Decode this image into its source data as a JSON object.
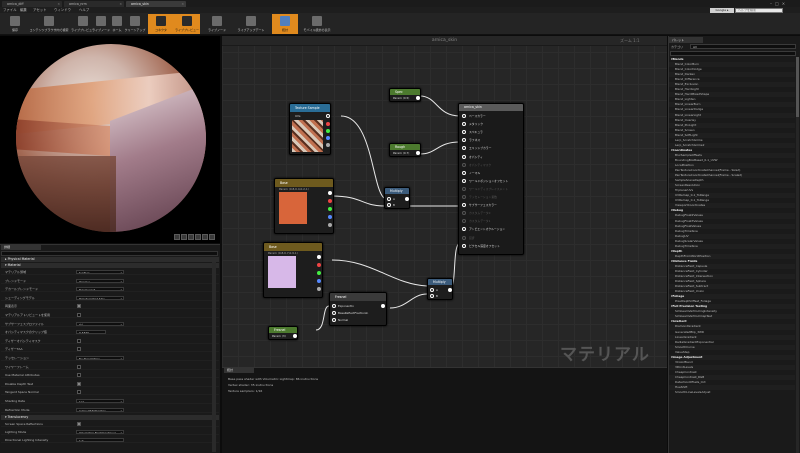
{
  "tabs": [
    {
      "label": "arnica_diff"
    },
    {
      "label": "arnica_nrm"
    },
    {
      "label": "arnica_skin"
    }
  ],
  "menu": [
    "ファイル",
    "編集",
    "アセット",
    "ウィンドウ",
    "ヘルプ"
  ],
  "search": {
    "label": "Google ▸",
    "placeholder": "ヘルプを検索"
  },
  "toolbar": [
    {
      "label": "保存",
      "on": false
    },
    {
      "label": "コンテンツブラウザ内で検索",
      "on": false
    },
    {
      "label": "ライブプレビュー",
      "on": false
    },
    {
      "label": "ライブノード",
      "on": false
    },
    {
      "label": "ライブアップデート",
      "on": false
    },
    {
      "label": "統計",
      "on": false
    },
    {
      "label": "ホーム",
      "on": false
    },
    {
      "label": "クリーンアップ",
      "on": false
    },
    {
      "label": "コネクタ",
      "on": true
    },
    {
      "label": "ライブプレビュー",
      "on": true
    },
    {
      "label": "ライブノード",
      "on": false
    },
    {
      "label": "ライブアップデート",
      "on": false
    },
    {
      "label": "統計",
      "on": true
    },
    {
      "label": "モバイル統計の表示",
      "on": false
    }
  ],
  "details": {
    "tab": "詳細",
    "sections": [
      {
        "title": "▸ Physical Material"
      },
      {
        "title": "▾ Material"
      },
      {
        "title": "▾ Translucency"
      }
    ],
    "props": [
      {
        "label": "マテリアル領域",
        "value": "Surface",
        "kind": "select"
      },
      {
        "label": "ブレンドモード",
        "value": "Opaque",
        "kind": "select"
      },
      {
        "label": "デカールブレンドモード",
        "value": "Translucent",
        "kind": "select"
      },
      {
        "label": "シェーディングモデル",
        "value": "Preintegrated Skin",
        "kind": "select"
      },
      {
        "label": "両面表示",
        "value": "",
        "kind": "check"
      },
      {
        "label": "マテリアルアトリビュートを使用",
        "value": "",
        "kind": "check"
      },
      {
        "label": "サブサーフェスプロファイル",
        "value": "なし",
        "kind": "select"
      },
      {
        "label": "オパシティマスクのクリップ値",
        "value": "0.3333",
        "kind": "text"
      },
      {
        "label": "ディザーオパシティマスク",
        "value": "",
        "kind": "check"
      },
      {
        "label": "ディザーTAA",
        "value": "",
        "kind": "check"
      },
      {
        "label": "テッセレーション",
        "value": "No Tessellation",
        "kind": "select"
      },
      {
        "label": "ワイヤーフレーム",
        "value": "",
        "kind": "check"
      },
      {
        "label": "Use Material Attributes",
        "value": "",
        "kind": "check"
      },
      {
        "label": "Disable Depth Test",
        "value": "",
        "kind": "check"
      },
      {
        "label": "Tangent Space Normal",
        "value": "",
        "kind": "check"
      },
      {
        "label": "Shading Rate",
        "value": "1x1",
        "kind": "select"
      },
      {
        "label": "Refraction Mode",
        "value": "Index Of Refraction",
        "kind": "select"
      }
    ],
    "trans_props": [
      {
        "label": "Screen Space Reflections",
        "value": "",
        "kind": "check"
      },
      {
        "label": "Lighting Mode",
        "value": "Volumetric NonDirectional",
        "kind": "select"
      },
      {
        "label": "Directional Lighting Intensity",
        "value": "1.0",
        "kind": "text"
      }
    ]
  },
  "graph": {
    "title": "arnica_skin",
    "zoom": "ズーム 1:1",
    "watermark": "マテリアル",
    "nodes": {
      "tex": {
        "title": "Texture Sample",
        "pin": "UVs"
      },
      "spec": {
        "title": "Spec",
        "sub": "Param (0.5)"
      },
      "rough": {
        "title": "Rough",
        "sub": "Param (0.7)"
      },
      "base": {
        "title": "Base",
        "sub": "Param (0.8,0.4,0.2,1)"
      },
      "mult1": {
        "title": "Multiply",
        "a": "A",
        "b": "B"
      },
      "sss": {
        "title": "Base",
        "sub": "Param (0.8,0.7,0.9,1)"
      },
      "fresnel": {
        "title": "Fresnel",
        "pins": [
          "ExponentIn",
          "BaseReflectFractionIn",
          "Normal"
        ]
      },
      "fres_param": {
        "title": "Fresnel",
        "sub": "Param (3)"
      },
      "mult2": {
        "title": "Multiply",
        "a": "A",
        "b": "B"
      },
      "main": {
        "title": "arnica_skin",
        "pins": [
          "ベースカラー",
          "メタリック",
          "スペキュラ",
          "ラフネス",
          "エミッシブカラー",
          "オパシティ",
          "オパシティマスク",
          "ノーマル",
          "ワールドポジションオフセット",
          "ワールドディスプレイスメント",
          "テッセレーション乗数",
          "サブサーフェスカラー",
          "カスタムデータ0",
          "カスタムデータ1",
          "アンビエントオクルージョン",
          "屈折",
          "ピクセル深度オフセット"
        ],
        "active": [
          true,
          true,
          true,
          true,
          true,
          true,
          false,
          true,
          true,
          false,
          false,
          true,
          false,
          false,
          true,
          false,
          true
        ]
      }
    }
  },
  "stats": {
    "tab": "統計",
    "lines": [
      "Base pass shader with Volumetric Lightmap: 86 instructions",
      "Vertex shader: 35 instructions",
      "Texture samplers: 1/16"
    ]
  },
  "palette": {
    "tab": "パレット",
    "category_label": "カテゴリ",
    "category_value": "All",
    "items": [
      {
        "t": "▾Blends",
        "c": true
      },
      {
        "t": "Blend_ColorBurn"
      },
      {
        "t": "Blend_ColorDodge"
      },
      {
        "t": "Blend_Darken"
      },
      {
        "t": "Blend_Difference"
      },
      {
        "t": "Blend_Exclusion"
      },
      {
        "t": "Blend_HardLight"
      },
      {
        "t": "Blend_HardMixedShape"
      },
      {
        "t": "Blend_Lighten"
      },
      {
        "t": "Blend_LinearBurn"
      },
      {
        "t": "Blend_LinearDodge"
      },
      {
        "t": "Blend_LinearLight"
      },
      {
        "t": "Blend_Overlay"
      },
      {
        "t": "Blend_PinLight"
      },
      {
        "t": "Blend_Screen"
      },
      {
        "t": "Blend_SoftLight"
      },
      {
        "t": "Lerp_ScratchGrime"
      },
      {
        "t": "Lerp_ScratchGrime2"
      },
      {
        "t": "▾Coordinates",
        "c": true
      },
      {
        "t": "BlurSampleOffsets"
      },
      {
        "t": "BoundingBoxBased_0-1_UVW"
      },
      {
        "t": "LocalPosition"
      },
      {
        "t": "PanTextureCoordinateChannel(Frame - Sized)"
      },
      {
        "t": "PanTextureCoordinateChannel(Frame - Scaled)"
      },
      {
        "t": "SampleSceneDepth"
      },
      {
        "t": "ScreenResolution"
      },
      {
        "t": "TriplanarUVs"
      },
      {
        "t": "UVRemap_0-1_ToRange"
      },
      {
        "t": "UVRemap_0-1_ToRange"
      },
      {
        "t": "ViewportCoordinates"
      },
      {
        "t": "▾Debug",
        "c": true
      },
      {
        "t": "DebugFloat2Values"
      },
      {
        "t": "DebugFloat3Values"
      },
      {
        "t": "DebugFloatValues"
      },
      {
        "t": "DebugTimeSine"
      },
      {
        "t": "DebugUV"
      },
      {
        "t": "DebugScalarValues"
      },
      {
        "t": "DebugTimeSine"
      },
      {
        "t": "▾Depth",
        "c": true
      },
      {
        "t": "DepthFromWorldPosition"
      },
      {
        "t": "▾Distance Fields",
        "c": true
      },
      {
        "t": "DistanceField_Capsule"
      },
      {
        "t": "DistanceField_Cylinder"
      },
      {
        "t": "DistanceField_Intersection"
      },
      {
        "t": "DistanceField_Sphere"
      },
      {
        "t": "DistanceField_Subtract"
      },
      {
        "t": "DistanceField_Union"
      },
      {
        "t": "▾Foliage",
        "c": true
      },
      {
        "t": "PixelDepthOffset_Foliage"
      },
      {
        "t": "▾Full Precision Testing",
        "c": true
      },
      {
        "t": "SimbeamVertCullingIntensity"
      },
      {
        "t": "SimbeamVertCullmapTest"
      },
      {
        "t": "▾Gradient",
        "c": true
      },
      {
        "t": "DiamondGradient"
      },
      {
        "t": "GeneratedBlip_3WR"
      },
      {
        "t": "LinearGradient"
      },
      {
        "t": "RadialGradientExponential"
      },
      {
        "t": "SmoothCurve"
      },
      {
        "t": "ValueStep"
      },
      {
        "t": "▾Image Adjustment",
        "c": true
      },
      {
        "t": "3ColorBlend"
      },
      {
        "t": "3PointLevels"
      },
      {
        "t": "CheapContrast"
      },
      {
        "t": "CheapContrast_RGB"
      },
      {
        "t": "DetectionOffsets_Oct"
      },
      {
        "t": "HueShift"
      },
      {
        "t": "SmoothLineLevelsAdjust"
      }
    ]
  }
}
